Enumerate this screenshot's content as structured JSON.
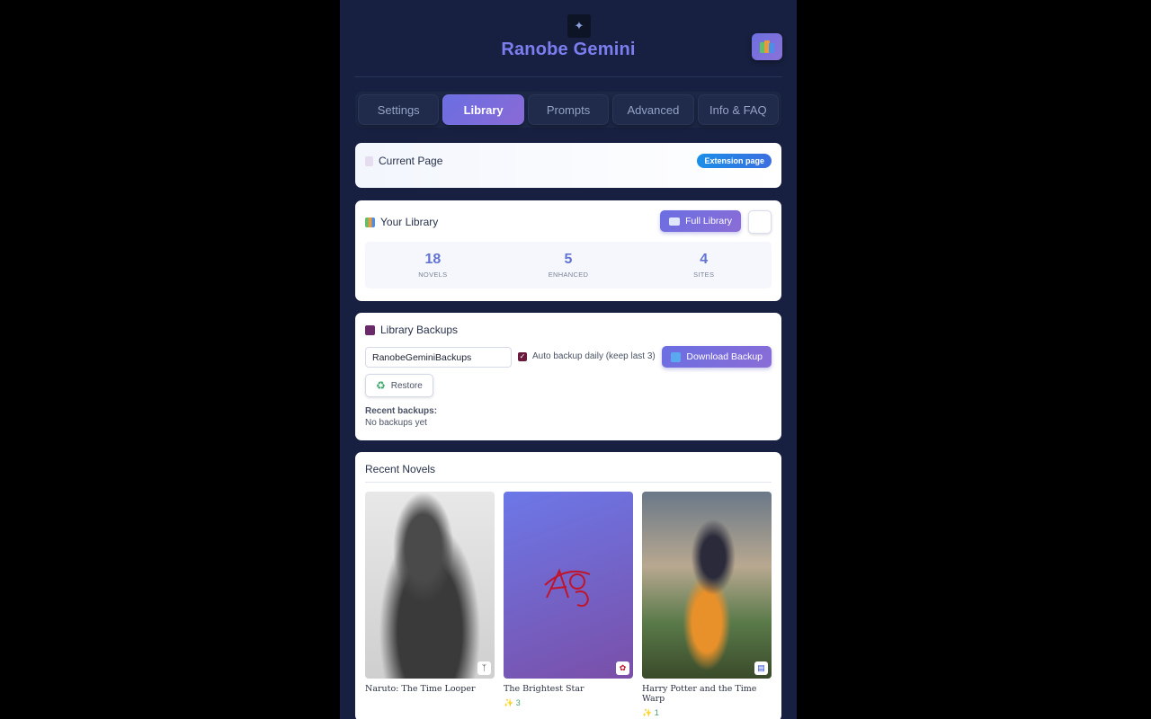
{
  "header": {
    "title": "Ranobe Gemini",
    "app_icon": "gemini-extension-icon",
    "corner_button_icon": "books-icon"
  },
  "tabs": [
    {
      "label": "Settings",
      "active": false
    },
    {
      "label": "Library",
      "active": true
    },
    {
      "label": "Prompts",
      "active": false
    },
    {
      "label": "Advanced",
      "active": false
    },
    {
      "label": "Info & FAQ",
      "active": false
    }
  ],
  "current_page": {
    "title": "Current Page",
    "badge": "Extension page"
  },
  "library": {
    "title": "Your Library",
    "full_library_label": "Full Library",
    "stats": [
      {
        "value": "18",
        "label": "NOVELS"
      },
      {
        "value": "5",
        "label": "ENHANCED"
      },
      {
        "value": "4",
        "label": "SITES"
      }
    ]
  },
  "backups": {
    "title": "Library Backups",
    "folder_value": "RanobeGeminiBackups",
    "auto_backup_label": "Auto backup daily (keep last 3)",
    "auto_backup_checked": true,
    "download_label": "Download Backup",
    "restore_label": "Restore",
    "recent_label": "Recent backups:",
    "recent_value": "No backups yet"
  },
  "recent_novels": {
    "title": "Recent Novels",
    "items": [
      {
        "name": "Naruto: The Time Looper",
        "meta": "",
        "site_icon": "fanfiction-icon"
      },
      {
        "name": "The Brightest Star",
        "meta": "3",
        "site_icon": "ao3-icon"
      },
      {
        "name": "Harry Potter and the Time Warp",
        "meta": "1",
        "site_icon": "document-icon"
      }
    ]
  },
  "colors": {
    "accent": "#6a6ee2",
    "panel_bg": "#172040",
    "stat_number": "#6274d3"
  }
}
